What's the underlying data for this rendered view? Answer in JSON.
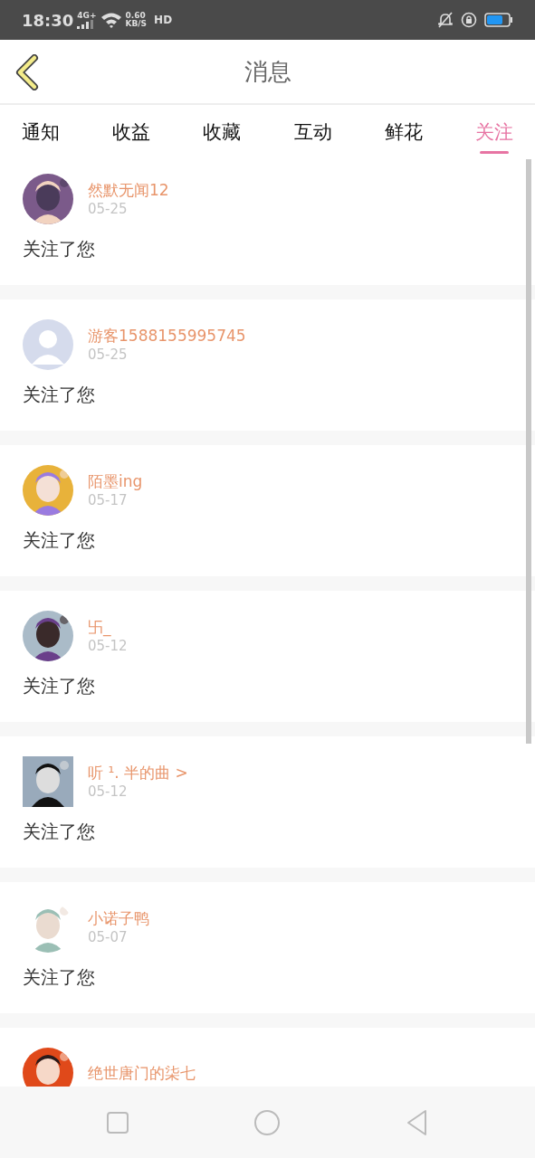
{
  "status_bar": {
    "time": "18:30",
    "network": "4G+",
    "speed_value": "0.60",
    "speed_unit": "KB/S",
    "hd": "HD"
  },
  "header": {
    "title": "消息"
  },
  "tabs": [
    {
      "label": "通知",
      "selected": false
    },
    {
      "label": "收益",
      "selected": false
    },
    {
      "label": "收藏",
      "selected": false
    },
    {
      "label": "互动",
      "selected": false
    },
    {
      "label": "鲜花",
      "selected": false
    },
    {
      "label": "关注",
      "selected": true
    }
  ],
  "messages": [
    {
      "avatar": {
        "kind": "round"
      },
      "name": "然默无闻12",
      "date": "05-25",
      "text": "关注了您"
    },
    {
      "avatar": {
        "kind": "default"
      },
      "name": "游客1588155995745",
      "date": "05-25",
      "text": "关注了您"
    },
    {
      "avatar": {
        "kind": "round"
      },
      "name": "陌墨ing",
      "date": "05-17",
      "text": "关注了您"
    },
    {
      "avatar": {
        "kind": "round"
      },
      "name": "卐_",
      "date": "05-12",
      "text": "关注了您"
    },
    {
      "avatar": {
        "kind": "square"
      },
      "name": "听 ¹. 半的曲 >",
      "date": "05-12",
      "text": "关注了您"
    },
    {
      "avatar": {
        "kind": "round"
      },
      "name": "小诺子鸭",
      "date": "05-07",
      "text": "关注了您"
    },
    {
      "avatar": {
        "kind": "round"
      },
      "name": "绝世唐门的柒七"
    }
  ]
}
